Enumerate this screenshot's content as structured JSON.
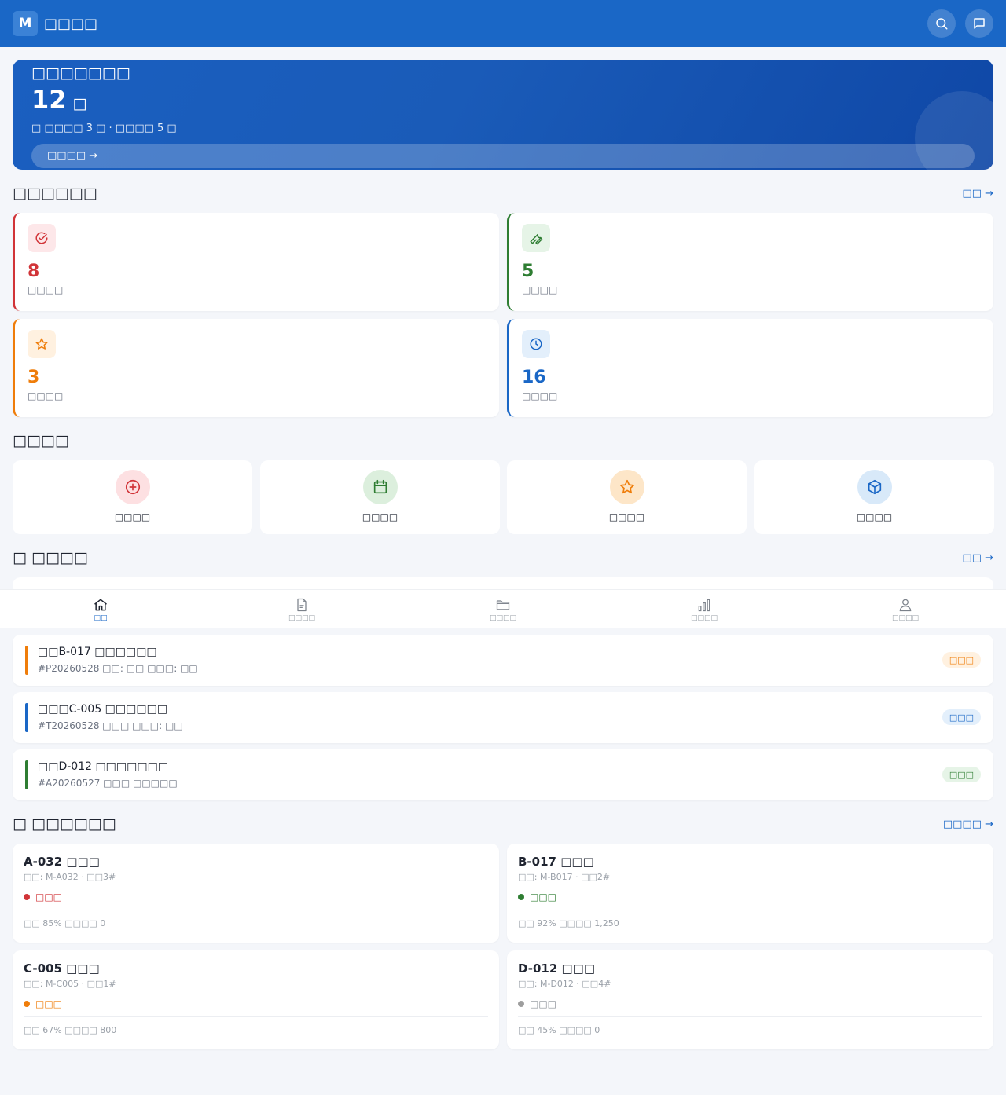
{
  "header": {
    "logo": "M",
    "title": "□□□□"
  },
  "hero": {
    "title": "□□□□□□□",
    "count": "12",
    "unit": "□",
    "subtitle": "□ □□□□ 3 □ · □□□□ 5 □",
    "action": "□□□□ →"
  },
  "overview": {
    "title": "□□□□□□",
    "more": "□□ →",
    "cards": [
      {
        "value": "8",
        "label": "□□□□",
        "icon": "check-circle-icon",
        "color": "#d13438"
      },
      {
        "value": "5",
        "label": "□□□□",
        "icon": "wrench-icon",
        "color": "#2e7d32"
      },
      {
        "value": "3",
        "label": "□□□□",
        "icon": "star-icon",
        "color": "#ef7d0a"
      },
      {
        "value": "16",
        "label": "□□□□",
        "icon": "clock-icon",
        "color": "#1a67c6"
      }
    ]
  },
  "quick": {
    "title": "□□□□",
    "items": [
      {
        "label": "□□□□",
        "icon": "plus-circle-icon"
      },
      {
        "label": "□□□□",
        "icon": "calendar-icon"
      },
      {
        "label": "□□□□",
        "icon": "star-icon"
      },
      {
        "label": "□□□□",
        "icon": "cube-icon"
      }
    ]
  },
  "tasks": {
    "title": "□ □□□□",
    "more": "□□ →",
    "items": [
      {
        "title": "□□B-017 □□□□□□",
        "meta": "#P20260528  □□: □□  □□□: □□",
        "badge": "□□□",
        "color": "#ef7d0a"
      },
      {
        "title": "□□□C-005 □□□□□□",
        "meta": "#T20260528  □□□  □□□: □□",
        "badge": "□□□",
        "color": "#1a67c6"
      },
      {
        "title": "□□D-012 □□□□□□□",
        "meta": "#A20260527  □□□  □□□□□",
        "badge": "□□□",
        "color": "#2e7d32"
      }
    ]
  },
  "devices": {
    "title": "□ □□□□□□",
    "more": "□□□□ →",
    "items": [
      {
        "name": "A-032 □□□",
        "sub": "□□: M-A032 · □□3#",
        "status": "□□□",
        "status_color": "#d13438",
        "footer": "□□ 85%   □□□□ 0"
      },
      {
        "name": "B-017 □□□",
        "sub": "□□: M-B017 · □□2#",
        "status": "□□□",
        "status_color": "#2e7d32",
        "footer": "□□ 92%   □□□□ 1,250"
      },
      {
        "name": "C-005 □□□",
        "sub": "□□: M-C005 · □□1#",
        "status": "□□□",
        "status_color": "#ef7d0a",
        "footer": "□□ 67%   □□□□ 800"
      },
      {
        "name": "D-012 □□□",
        "sub": "□□: M-D012 · □□4#",
        "status": "□□□",
        "status_color": "#9e9e9e",
        "footer": "□□ 45%   □□□□ 0"
      }
    ]
  },
  "nav": {
    "active": 0,
    "items": [
      {
        "label": "□□",
        "icon": "home-icon"
      },
      {
        "label": "□□□□",
        "icon": "document-icon"
      },
      {
        "label": "□□□□",
        "icon": "folder-icon"
      },
      {
        "label": "□□□□",
        "icon": "bar-chart-icon"
      },
      {
        "label": "□□□□",
        "icon": "user-icon"
      }
    ]
  }
}
